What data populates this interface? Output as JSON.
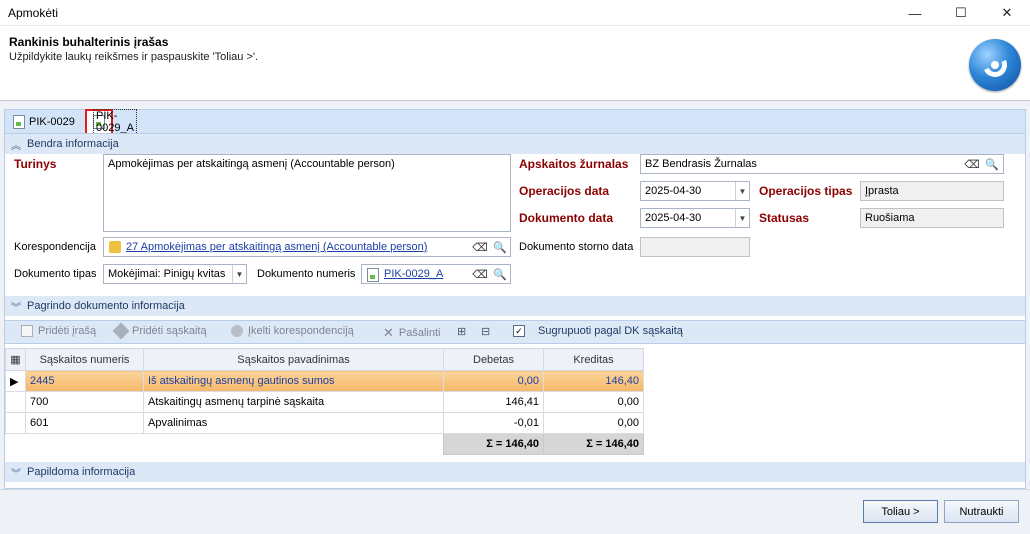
{
  "window": {
    "title": "Apmokėti",
    "min": "—",
    "max": "☐",
    "close": "✕"
  },
  "header": {
    "title": "Rankinis buhalterinis įrašas",
    "subtitle": "Užpildykite laukų reikšmes ir paspauskite 'Toliau >'."
  },
  "tabs": [
    {
      "label": "PIK-0029"
    },
    {
      "label": "PIK-0029_A"
    }
  ],
  "sections": {
    "general": "Bendra informacija",
    "base_doc": "Pagrindo dokumento informacija",
    "additional": "Papildoma informacija"
  },
  "form": {
    "content_label": "Turinys",
    "content_value": "Apmokėjimas per atskaitingą asmenį (Accountable person)",
    "correspondence_label": "Korespondencija",
    "correspondence_value": "27 Apmokėjimas per atskaitingą asmenį (Accountable person)",
    "doc_type_label": "Dokumento tipas",
    "doc_type_value": "Mokėjimai: Pinigų kvitas",
    "doc_number_label": "Dokumento numeris",
    "doc_number_value": "PIK-0029_A",
    "journal_label": "Apskaitos žurnalas",
    "journal_value": "BZ Bendrasis Žurnalas",
    "op_date_label": "Operacijos data",
    "op_date_value": "2025-04-30",
    "op_type_label": "Operacijos tipas",
    "op_type_value": "Įprasta",
    "doc_date_label": "Dokumento data",
    "doc_date_value": "2025-04-30",
    "status_label": "Statusas",
    "status_value": "Ruošiama",
    "storno_label": "Dokumento storno data",
    "storno_value": ""
  },
  "toolbar": {
    "add_entry": "Pridėti įrašą",
    "add_account": "Pridėti sąskaitą",
    "load_corr": "Įkelti korespondenciją",
    "remove": "Pašalinti",
    "group_label": "Sugrupuoti pagal DK sąskaitą",
    "group_checked": "✓"
  },
  "grid": {
    "columns": [
      "Sąskaitos numeris",
      "Sąskaitos pavadinimas",
      "Debetas",
      "Kreditas"
    ],
    "rows": [
      {
        "num": "2445",
        "name": "Iš atskaitingų asmenų gautinos sumos",
        "debit": "0,00",
        "credit": "146,40"
      },
      {
        "num": "700",
        "name": "Atskaitingų asmenų tarpinė sąskaita",
        "debit": "146,41",
        "credit": "0,00"
      },
      {
        "num": "601",
        "name": "Apvalinimas",
        "debit": "-0,01",
        "credit": "0,00"
      }
    ],
    "sum_debit": "Σ = 146,40",
    "sum_credit": "Σ = 146,40"
  },
  "buttons": {
    "next": "Toliau >",
    "cancel": "Nutraukti"
  },
  "colors": {
    "accent": "#1f3a64",
    "required_label": "#8b0000",
    "selected_row": "#f5b768",
    "tab_highlight": "#e31c1c"
  }
}
